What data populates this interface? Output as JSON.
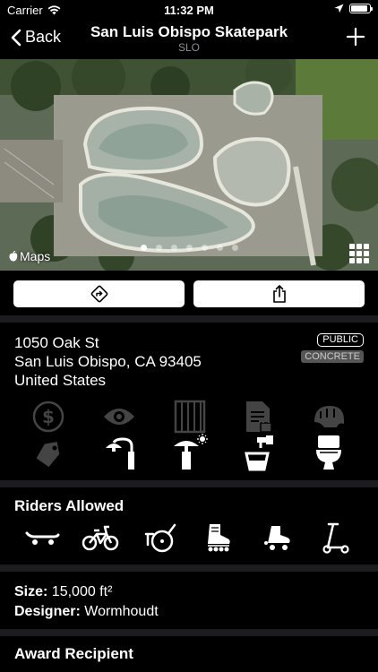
{
  "status_bar": {
    "carrier": "Carrier",
    "time": "11:32 PM",
    "battery_level": 0.9
  },
  "nav": {
    "back_label": "Back",
    "title": "San Luis Obispo Skatepark",
    "subtitle": "SLO"
  },
  "map": {
    "attribution": "Maps",
    "page_count": 7,
    "active_page": 0
  },
  "address": {
    "line1": "1050 Oak St",
    "line2": "San Luis Obispo, CA 93405",
    "line3": "United States"
  },
  "tags": {
    "access": "PUBLIC",
    "surface": "CONCRETE"
  },
  "amenities": [
    {
      "icon": "paid-icon",
      "active": false
    },
    {
      "icon": "eye-icon",
      "active": false
    },
    {
      "icon": "fence-icon",
      "active": false
    },
    {
      "icon": "waiver-icon",
      "active": false
    },
    {
      "icon": "helmet-icon",
      "active": false
    },
    {
      "icon": "price-tag-icon",
      "active": false
    },
    {
      "icon": "street-light-icon",
      "active": true
    },
    {
      "icon": "shade-umbrella-icon",
      "active": true
    },
    {
      "icon": "water-fountain-icon",
      "active": true
    },
    {
      "icon": "restroom-icon",
      "active": true
    }
  ],
  "riders": {
    "title": "Riders Allowed",
    "items": [
      "skateboard-icon",
      "bmx-bike-icon",
      "scooter-wheel-icon",
      "inline-skate-icon",
      "roller-skate-icon",
      "kick-scooter-icon"
    ]
  },
  "details": {
    "size_label": "Size:",
    "size_value": "15,000 ft²",
    "designer_label": "Designer:",
    "designer_value": "Wormhoudt"
  },
  "award": {
    "title": "Award Recipient"
  }
}
